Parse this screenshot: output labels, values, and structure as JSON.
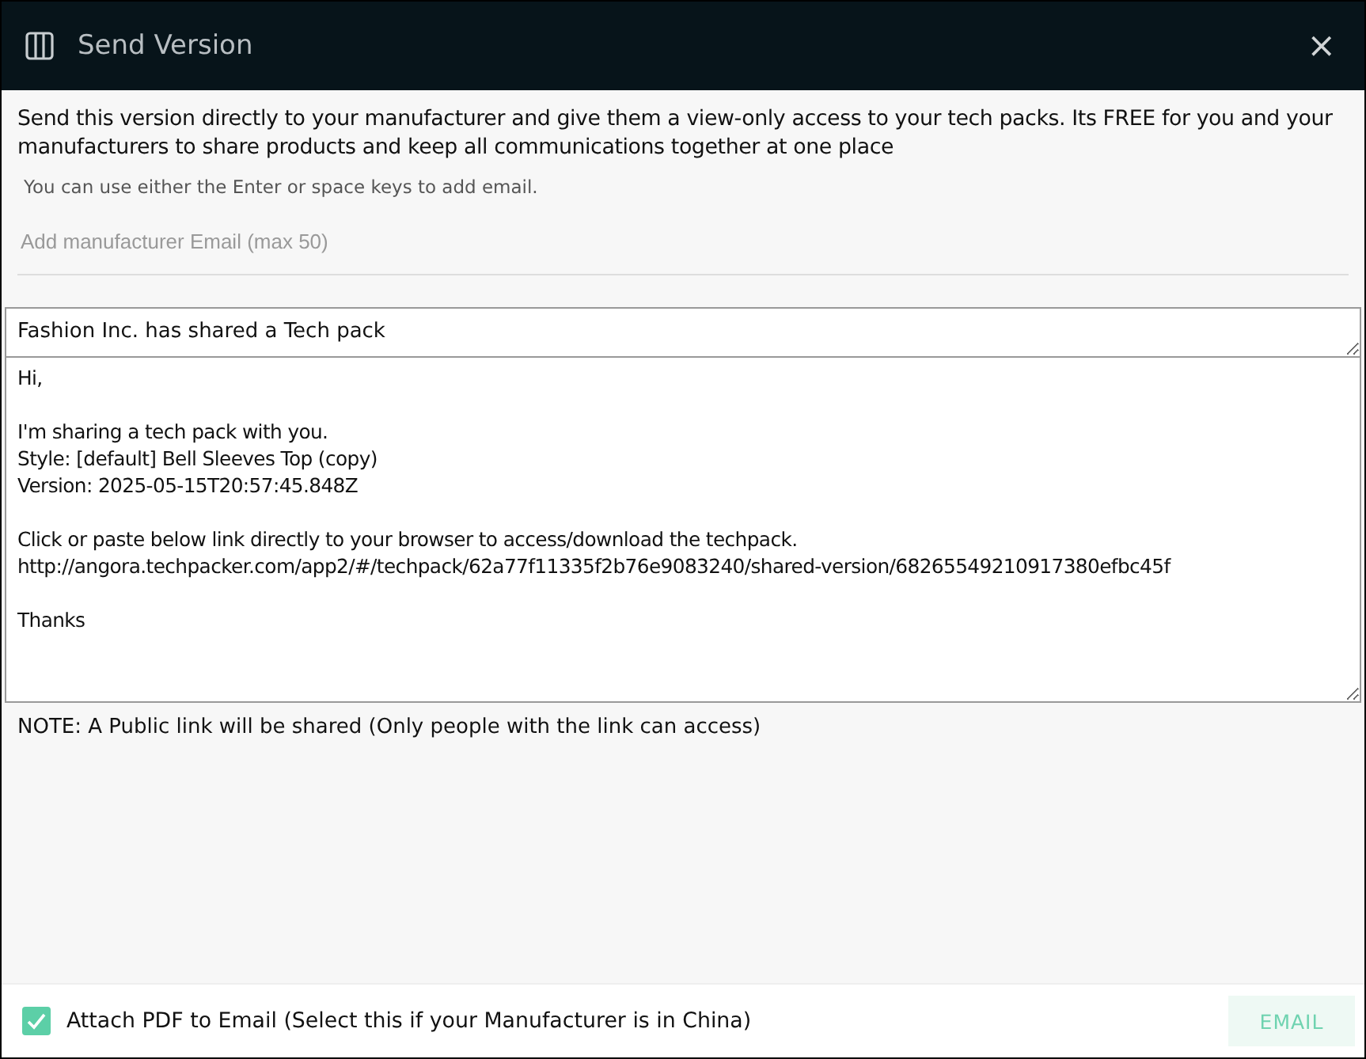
{
  "window": {
    "title": "Send Version",
    "close": "×"
  },
  "intro": "Send this version directly to your manufacturer and give them a view-only access to your tech packs. Its FREE for you and your manufacturers to share products and keep all communications together at one place",
  "hint": "You can use either the Enter or space keys to add email.",
  "email_field": {
    "placeholder": "Add manufacturer Email (max 50)"
  },
  "subject": "Fashion Inc. has shared a Tech pack",
  "message": "Hi,\n\nI'm sharing a tech pack with you.\nStyle: [default] Bell Sleeves Top (copy)\nVersion: 2025-05-15T20:57:45.848Z\n\nClick or paste below link directly to your browser to access/download the techpack.\nhttp://angora.techpacker.com/app2/#/techpack/62a77f11335f2b76e9083240/shared-version/68265549210917380efbc45f\n\nThanks",
  "note": "NOTE: A Public link will be shared (Only people with the link can access)",
  "attach": {
    "label": "Attach PDF to Email (Select this if your Manufacturer is in China)",
    "checked": true
  },
  "send_button": {
    "label": "EMAIL",
    "disabled": true
  }
}
